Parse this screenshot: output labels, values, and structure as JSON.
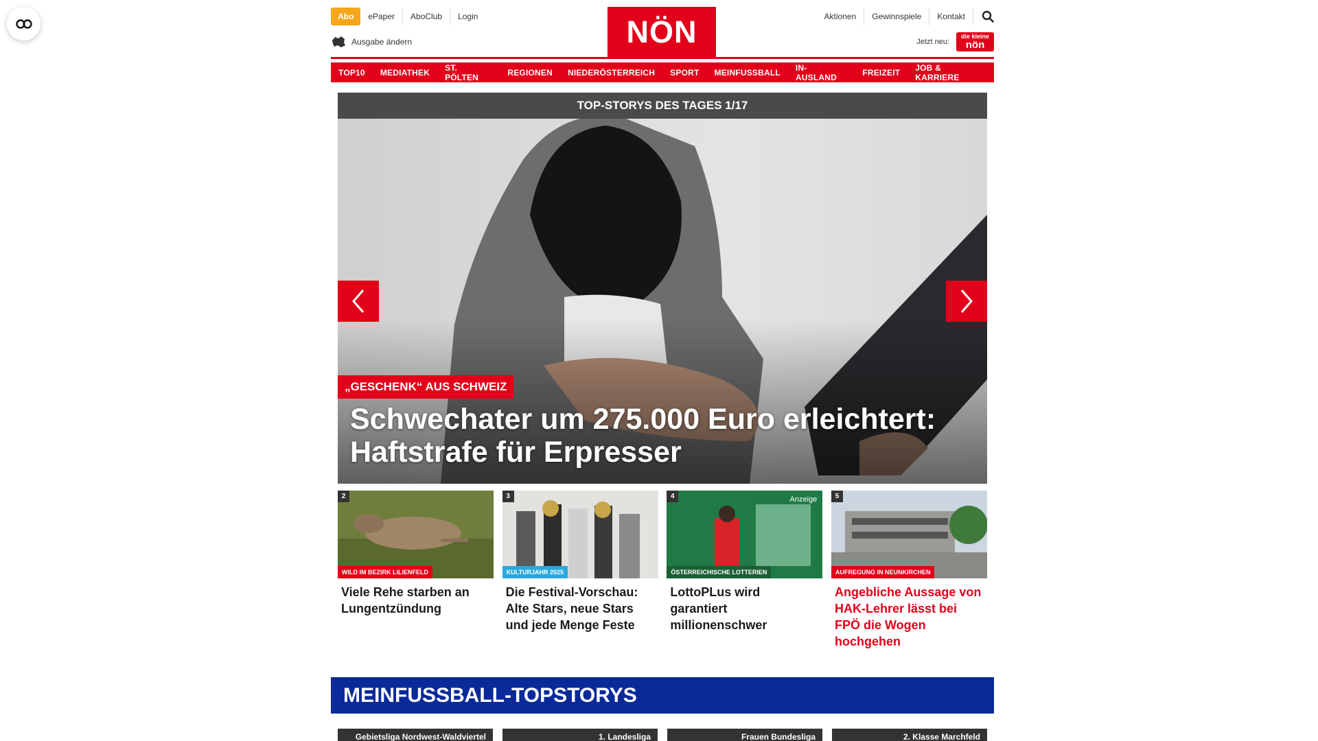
{
  "header": {
    "abo_label": "Abo",
    "top_links": [
      "ePaper",
      "AboClub",
      "Login"
    ],
    "ausgabe_label": "Ausgabe ändern",
    "logo_text": "NÖN",
    "right_links": [
      "Aktionen",
      "Gewinnspiele",
      "Kontakt"
    ],
    "jetzt_label": "Jetzt neu:",
    "jetzt_badge_top": "die kleine",
    "jetzt_badge_bottom": "nön"
  },
  "nav": {
    "tabs": [
      "TOP10",
      "MEDIATHEK",
      "ST. PÖLTEN",
      "REGIONEN",
      "NIEDERÖSTERREICH",
      "SPORT",
      "MEINFUSSBALL",
      "IN-AUSLAND",
      "FREIZEIT",
      "JOB & KARRIERE"
    ]
  },
  "hero": {
    "bar_title": "TOP-STORYS DES TAGES 1/17",
    "tag": "„Geschenk“ aus Schweiz",
    "headline": "Schwechater um 275.000 Euro erleichtert: Haftstrafe für Erpresser"
  },
  "stories": [
    {
      "num": "2",
      "tag": "Wild im Bezirk Lilienfeld",
      "title": "Viele Rehe starben an Lungentzündung"
    },
    {
      "num": "3",
      "tag": "Kulturjahr 2025",
      "title": "Die Festival-Vorschau: Alte Stars, neue Stars und jede Menge Feste"
    },
    {
      "num": "4",
      "tag": "Österreichische Lotterien",
      "ad": "Anzeige",
      "title": "LottoPLus wird garantiert millionenschwer"
    },
    {
      "num": "5",
      "tag": "Aufregung in Neunkirchen",
      "title": "Angebliche Aussage von HAK-Lehrer lässt bei FPÖ die Wogen hochgehen"
    }
  ],
  "section": {
    "title": "MEINFUSSBALL-TOPSTORYS",
    "cards": [
      "Gebietsliga Nordwest-Waldviertel",
      "1. Landesliga",
      "Frauen Bundesliga",
      "2. Klasse Marchfeld"
    ]
  },
  "colors": {
    "brand_red": "#e2001a",
    "abo_orange": "#f6a619",
    "section_blue": "#0a2a9a",
    "kultur_blue": "#2aa8dc"
  }
}
